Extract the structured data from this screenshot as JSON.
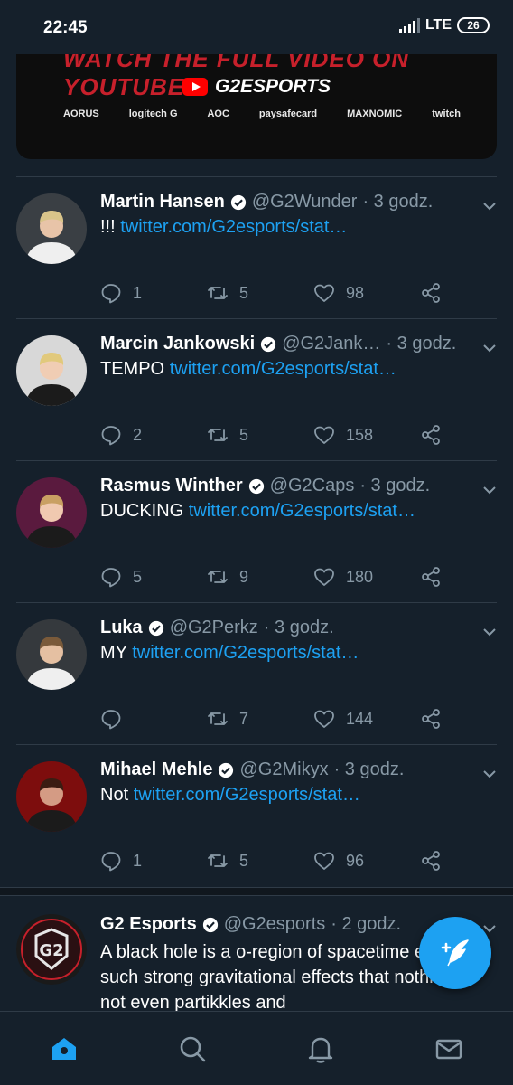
{
  "status_bar": {
    "time": "22:45",
    "network": "LTE",
    "battery": "26"
  },
  "media_card": {
    "banner_text": "WATCH THE FULL VIDEO ON YOUTUBE",
    "channel": "G2ESPORTS",
    "sponsors": [
      "AORUS",
      "logitech G",
      "AOC",
      "paysafecard",
      "MAXNOMIC",
      "twitch"
    ]
  },
  "tweets": [
    {
      "name": "Martin Hansen",
      "handle": "@G2Wunder",
      "time": "· 3 godz.",
      "text": "!!!",
      "link": "twitter.com/G2esports/stat…",
      "replies": "1",
      "retweets": "5",
      "likes": "98"
    },
    {
      "name": "Marcin Jankowski",
      "handle": "@G2Jank…",
      "time": "· 3 godz.",
      "text": "TEMPO",
      "link": "twitter.com/G2esports/stat…",
      "replies": "2",
      "retweets": "5",
      "likes": "158"
    },
    {
      "name": "Rasmus Winther",
      "handle": "@G2Caps",
      "time": "· 3 godz.",
      "text": "DUCKING",
      "link": "twitter.com/G2esports/stat…",
      "replies": "5",
      "retweets": "9",
      "likes": "180"
    },
    {
      "name": "Luka",
      "handle": "@G2Perkz",
      "time": "· 3 godz.",
      "text": "MY",
      "link": "twitter.com/G2esports/stat…",
      "replies": "",
      "retweets": "7",
      "likes": "144"
    },
    {
      "name": "Mihael Mehle",
      "handle": "@G2Mikyx",
      "time": "· 3 godz.",
      "text": "Not",
      "link": "twitter.com/G2esports/stat…",
      "replies": "1",
      "retweets": "5",
      "likes": "96"
    }
  ],
  "last_tweet": {
    "name": "G2 Esports",
    "handle": "@G2esports",
    "time": "· 2 godz.",
    "text": "A black hole is a o-region of spacetime exhibiting such strong gravitational effects that nothing—not even partikkles and"
  },
  "colors": {
    "background": "#15202b",
    "accent": "#1da1f2",
    "muted": "#8899a6"
  },
  "nav": [
    "home-icon",
    "search-icon",
    "bell-icon",
    "mail-icon"
  ]
}
